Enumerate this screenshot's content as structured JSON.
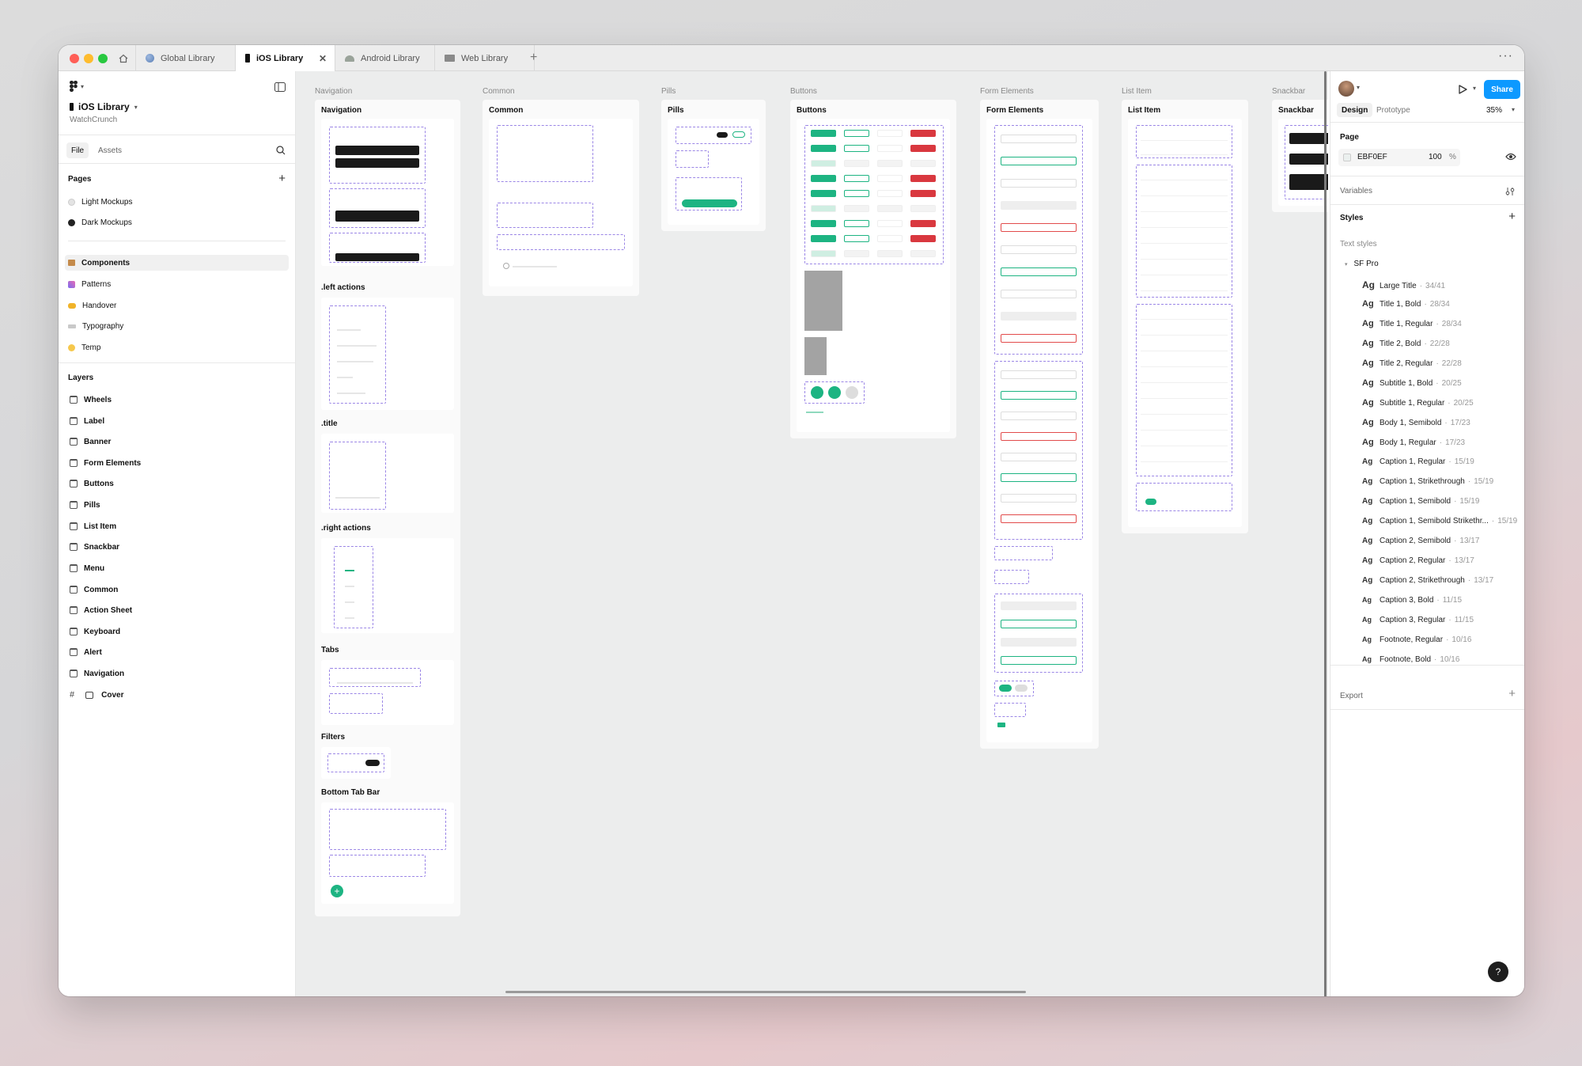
{
  "tabs": [
    {
      "label": "Global Library"
    },
    {
      "label": "iOS Library"
    },
    {
      "label": "Android Library"
    },
    {
      "label": "Web Library"
    }
  ],
  "sidebar": {
    "file_name": "iOS Library",
    "team": "WatchCrunch",
    "tab_file": "File",
    "tab_assets": "Assets",
    "pages_title": "Pages",
    "pages": [
      {
        "label": "Light Mockups"
      },
      {
        "label": "Dark Mockups"
      },
      {
        "label": "Components"
      },
      {
        "label": "Patterns"
      },
      {
        "label": "Handover"
      },
      {
        "label": "Typography"
      },
      {
        "label": "Temp"
      }
    ],
    "layers_title": "Layers",
    "layers": [
      {
        "label": "Wheels"
      },
      {
        "label": "Label"
      },
      {
        "label": "Banner"
      },
      {
        "label": "Form Elements"
      },
      {
        "label": "Buttons"
      },
      {
        "label": "Pills"
      },
      {
        "label": "List Item"
      },
      {
        "label": "Snackbar"
      },
      {
        "label": "Menu"
      },
      {
        "label": "Common"
      },
      {
        "label": "Action Sheet"
      },
      {
        "label": "Keyboard"
      },
      {
        "label": "Alert"
      },
      {
        "label": "Navigation"
      },
      {
        "label": "Cover"
      }
    ]
  },
  "canvas": {
    "frames": [
      {
        "label": "Navigation",
        "title": "Navigation"
      },
      {
        "label": "Common",
        "title": "Common"
      },
      {
        "label": "Pills",
        "title": "Pills"
      },
      {
        "label": "Buttons",
        "title": "Buttons"
      },
      {
        "label": "Form Elements",
        "title": "Form Elements"
      },
      {
        "label": "List Item",
        "title": "List Item"
      },
      {
        "label": "Snackbar",
        "title": "Snackbar"
      }
    ],
    "nav_sections": [
      ".left actions",
      ".title",
      ".right actions",
      "Tabs",
      "Filters",
      "Bottom Tab Bar"
    ]
  },
  "right_panel": {
    "share_label": "Share",
    "tab_design": "Design",
    "tab_prototype": "Prototype",
    "zoom": "35%",
    "page_title": "Page",
    "page_color": "EBF0EF",
    "page_opacity": "100",
    "percent_sign": "%",
    "variables_title": "Variables",
    "styles_title": "Styles",
    "text_styles_title": "Text styles",
    "font_group": "SF Pro",
    "text_styles": [
      {
        "name": "Large Title",
        "spec": "34/41"
      },
      {
        "name": "Title 1, Bold",
        "spec": "28/34"
      },
      {
        "name": "Title 1, Regular",
        "spec": "28/34"
      },
      {
        "name": "Title 2, Bold",
        "spec": "22/28"
      },
      {
        "name": "Title 2, Regular",
        "spec": "22/28"
      },
      {
        "name": "Subtitle 1, Bold",
        "spec": "20/25"
      },
      {
        "name": "Subtitle 1, Regular",
        "spec": "20/25"
      },
      {
        "name": "Body 1, Semibold",
        "spec": "17/23"
      },
      {
        "name": "Body 1, Regular",
        "spec": "17/23"
      },
      {
        "name": "Caption 1, Regular",
        "spec": "15/19"
      },
      {
        "name": "Caption 1, Strikethrough",
        "spec": "15/19"
      },
      {
        "name": "Caption 1, Semibold",
        "spec": "15/19"
      },
      {
        "name": "Caption 1, Semibold Strikethr...",
        "spec": "15/19"
      },
      {
        "name": "Caption 2, Semibold",
        "spec": "13/17"
      },
      {
        "name": "Caption 2, Regular",
        "spec": "13/17"
      },
      {
        "name": "Caption 2, Strikethrough",
        "spec": "13/17"
      },
      {
        "name": "Caption 3, Bold",
        "spec": "11/15"
      },
      {
        "name": "Caption 3, Regular",
        "spec": "11/15"
      },
      {
        "name": "Footnote, Regular",
        "spec": "10/16"
      },
      {
        "name": "Footnote, Bold",
        "spec": "10/16"
      }
    ],
    "export_title": "Export",
    "help_label": "?"
  },
  "colors": {
    "accent": "#0d99ff",
    "green": "#1db482",
    "red": "#d9383f",
    "canvas_bg": "#ECEDED"
  }
}
